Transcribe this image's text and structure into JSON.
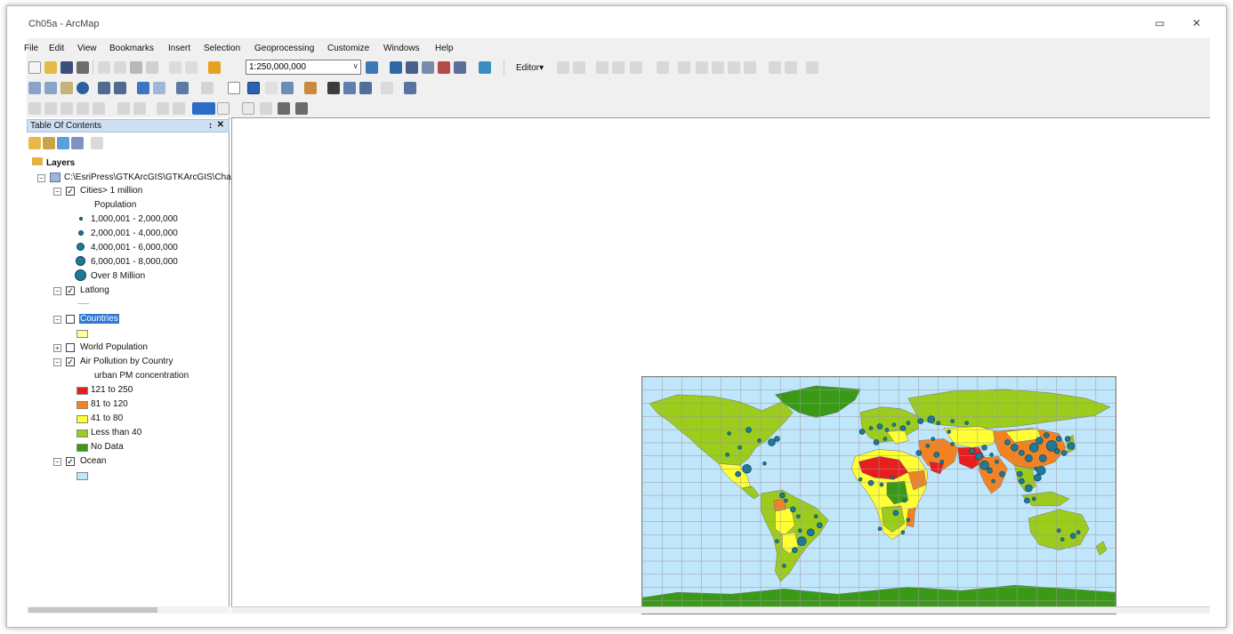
{
  "window": {
    "title": "Ch05a - ArcMap"
  },
  "menu": [
    "File",
    "Edit",
    "View",
    "Bookmarks",
    "Insert",
    "Selection",
    "Geoprocessing",
    "Customize",
    "Windows",
    "Help"
  ],
  "toolbar": {
    "scale_value": "1:250,000,000",
    "editor_label": "Editor▾"
  },
  "toc": {
    "title": "Table Of Contents",
    "layers_label": "Layers",
    "data_frame_path": "C:\\EsriPress\\GTKArcGIS\\GTKArcGIS\\Cha",
    "cities": {
      "name": "Cities> 1 million",
      "field": "Population",
      "classes": [
        "1,000,001 - 2,000,000",
        "2,000,001 - 4,000,000",
        "4,000,001 - 6,000,000",
        "6,000,001 - 8,000,000",
        "Over 8 Million"
      ]
    },
    "latlong": {
      "name": "Latlong"
    },
    "countries": {
      "name": "Countries",
      "color": "#ffff99"
    },
    "world_population": {
      "name": "World Population"
    },
    "air_pollution": {
      "name": "Air Pollution by Country",
      "field": "urban PM concentration",
      "classes": [
        {
          "label": "121 to 250",
          "color": "#e81d1d"
        },
        {
          "label": "81 to 120",
          "color": "#f58220"
        },
        {
          "label": "41 to 80",
          "color": "#ffff33"
        },
        {
          "label": "Less than 40",
          "color": "#9ccc1c"
        },
        {
          "label": "No Data",
          "color": "#3a9a18"
        }
      ]
    },
    "ocean": {
      "name": "Ocean",
      "color": "#bfe6fa"
    }
  },
  "map": {
    "ocean_color": "#c0e6fb",
    "graticule_color": "#9a9a9a",
    "city_color": "#1e7a97"
  }
}
